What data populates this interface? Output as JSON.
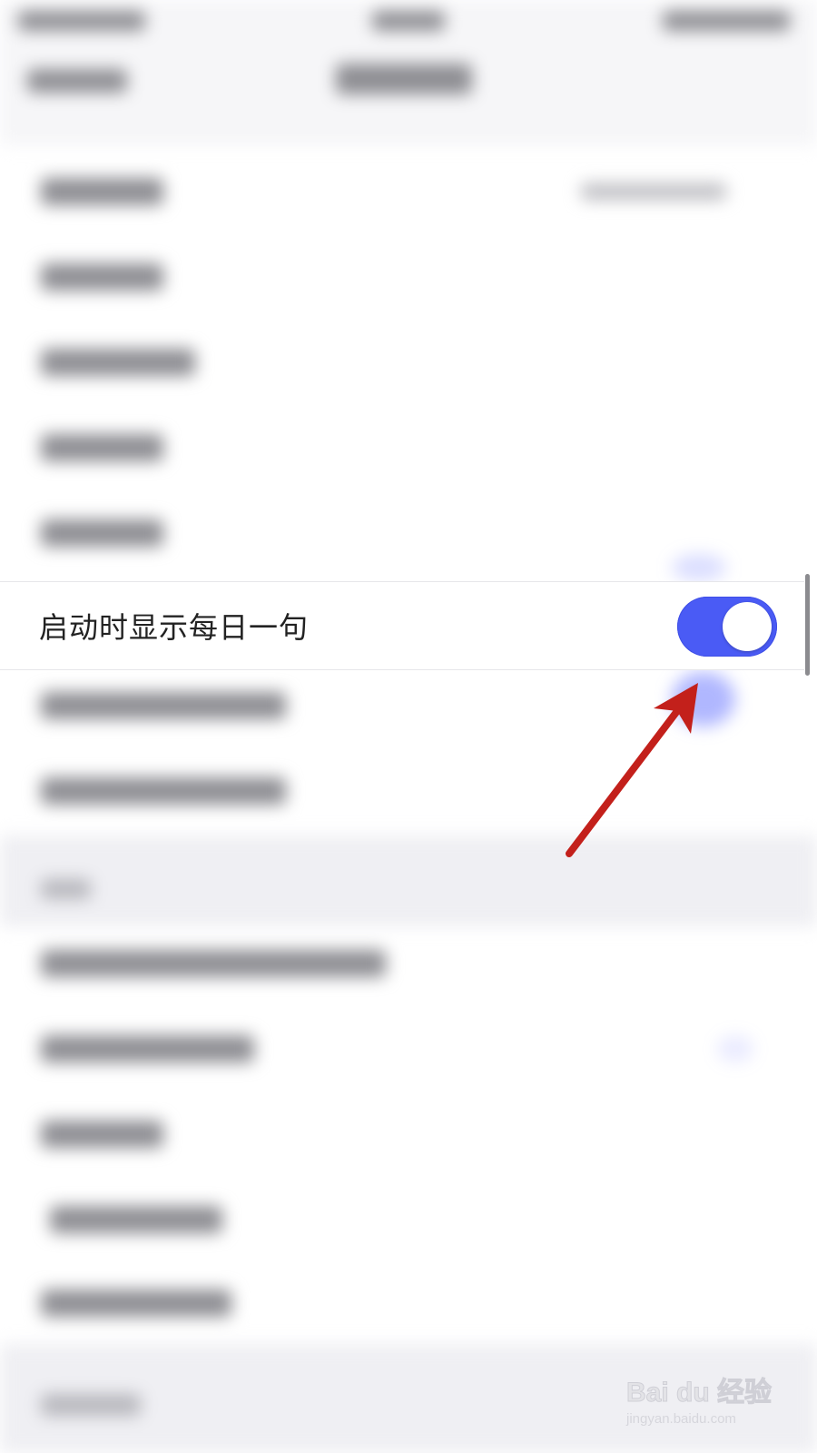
{
  "setting_row": {
    "label": "启动时显示每日一句",
    "toggle_state": "on"
  },
  "colors": {
    "toggle_on": "#4a5bf5",
    "arrow": "#c3201b"
  },
  "watermark": {
    "logo_text": "Bai du 经验",
    "url": "jingyan.baidu.com"
  },
  "icons": {
    "arrow": "red-annotation-arrow"
  }
}
